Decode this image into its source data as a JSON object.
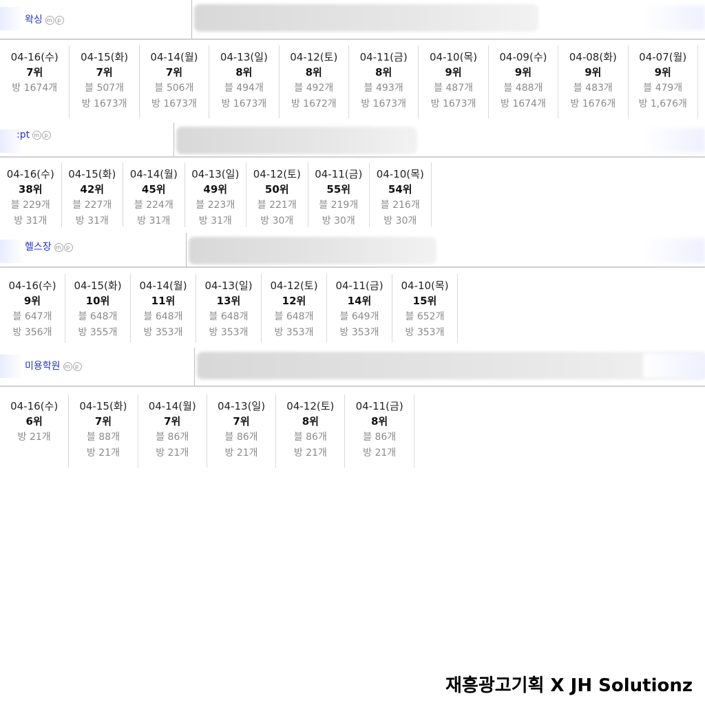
{
  "sections": [
    {
      "keyword": "왁싱",
      "icons": [
        "m-icon",
        "p-icon"
      ],
      "days": [
        {
          "date": "04-16(수)",
          "rank": "7위",
          "stats": [
            "방 1674개"
          ]
        },
        {
          "date": "04-15(화)",
          "rank": "7위",
          "stats": [
            "블 507개",
            "방 1673개"
          ]
        },
        {
          "date": "04-14(월)",
          "rank": "7위",
          "stats": [
            "블 506개",
            "방 1673개"
          ]
        },
        {
          "date": "04-13(일)",
          "rank": "8위",
          "stats": [
            "블 494개",
            "방 1673개"
          ]
        },
        {
          "date": "04-12(토)",
          "rank": "8위",
          "stats": [
            "블 492개",
            "방 1672개"
          ]
        },
        {
          "date": "04-11(금)",
          "rank": "8위",
          "stats": [
            "블 493개",
            "방 1673개"
          ]
        },
        {
          "date": "04-10(목)",
          "rank": "9위",
          "stats": [
            "블 487개",
            "방 1673개"
          ]
        },
        {
          "date": "04-09(수)",
          "rank": "9위",
          "stats": [
            "블 488개",
            "방 1674개"
          ]
        },
        {
          "date": "04-08(화)",
          "rank": "9위",
          "stats": [
            "블 483개",
            "방 1676개"
          ]
        },
        {
          "date": "04-07(월)",
          "rank": "9위",
          "stats": [
            "블 479개",
            "방 1,676개"
          ]
        }
      ]
    },
    {
      "keyword": ":pt",
      "icons": [
        "m-icon",
        "p-icon"
      ],
      "days": [
        {
          "date": "04-16(수)",
          "rank": "38위",
          "stats": [
            "블 229개",
            "방 31개"
          ]
        },
        {
          "date": "04-15(화)",
          "rank": "42위",
          "stats": [
            "블 227개",
            "방 31개"
          ]
        },
        {
          "date": "04-14(월)",
          "rank": "45위",
          "stats": [
            "블 224개",
            "방 31개"
          ]
        },
        {
          "date": "04-13(일)",
          "rank": "49위",
          "stats": [
            "블 223개",
            "방 31개"
          ]
        },
        {
          "date": "04-12(토)",
          "rank": "50위",
          "stats": [
            "블 221개",
            "방 30개"
          ]
        },
        {
          "date": "04-11(금)",
          "rank": "55위",
          "stats": [
            "블 219개",
            "방 30개"
          ]
        },
        {
          "date": "04-10(목)",
          "rank": "54위",
          "stats": [
            "블 216개",
            "방 30개"
          ]
        }
      ]
    },
    {
      "keyword": "헬스장",
      "icons": [
        "m-icon",
        "p-icon"
      ],
      "days": [
        {
          "date": "04-16(수)",
          "rank": "9위",
          "stats": [
            "블 647개",
            "방 356개"
          ]
        },
        {
          "date": "04-15(화)",
          "rank": "10위",
          "stats": [
            "블 648개",
            "방 355개"
          ]
        },
        {
          "date": "04-14(월)",
          "rank": "11위",
          "stats": [
            "블 648개",
            "방 353개"
          ]
        },
        {
          "date": "04-13(일)",
          "rank": "13위",
          "stats": [
            "블 648개",
            "방 353개"
          ]
        },
        {
          "date": "04-12(토)",
          "rank": "12위",
          "stats": [
            "블 648개",
            "방 353개"
          ]
        },
        {
          "date": "04-11(금)",
          "rank": "14위",
          "stats": [
            "블 649개",
            "방 353개"
          ]
        },
        {
          "date": "04-10(목)",
          "rank": "15위",
          "stats": [
            "블 652개",
            "방 353개"
          ]
        }
      ]
    },
    {
      "keyword": "미용학원",
      "icons": [
        "m-icon",
        "p-icon"
      ],
      "days": [
        {
          "date": "04-16(수)",
          "rank": "6위",
          "stats": [
            "방 21개"
          ]
        },
        {
          "date": "04-15(화)",
          "rank": "7위",
          "stats": [
            "블 88개",
            "방 21개"
          ]
        },
        {
          "date": "04-14(월)",
          "rank": "7위",
          "stats": [
            "블 86개",
            "방 21개"
          ]
        },
        {
          "date": "04-13(일)",
          "rank": "7위",
          "stats": [
            "블 86개",
            "방 21개"
          ]
        },
        {
          "date": "04-12(토)",
          "rank": "8위",
          "stats": [
            "블 86개",
            "방 21개"
          ]
        },
        {
          "date": "04-11(금)",
          "rank": "8위",
          "stats": [
            "블 86개",
            "방 21개"
          ]
        }
      ]
    }
  ],
  "icon_glyphs": {
    "m-icon": "m",
    "p-icon": "p"
  },
  "colors": {
    "keyword": "#2233cc",
    "stat": "#8a8a8a",
    "rank": "#111111"
  },
  "watermark": "재흥광고기획 X JH Solutionz"
}
